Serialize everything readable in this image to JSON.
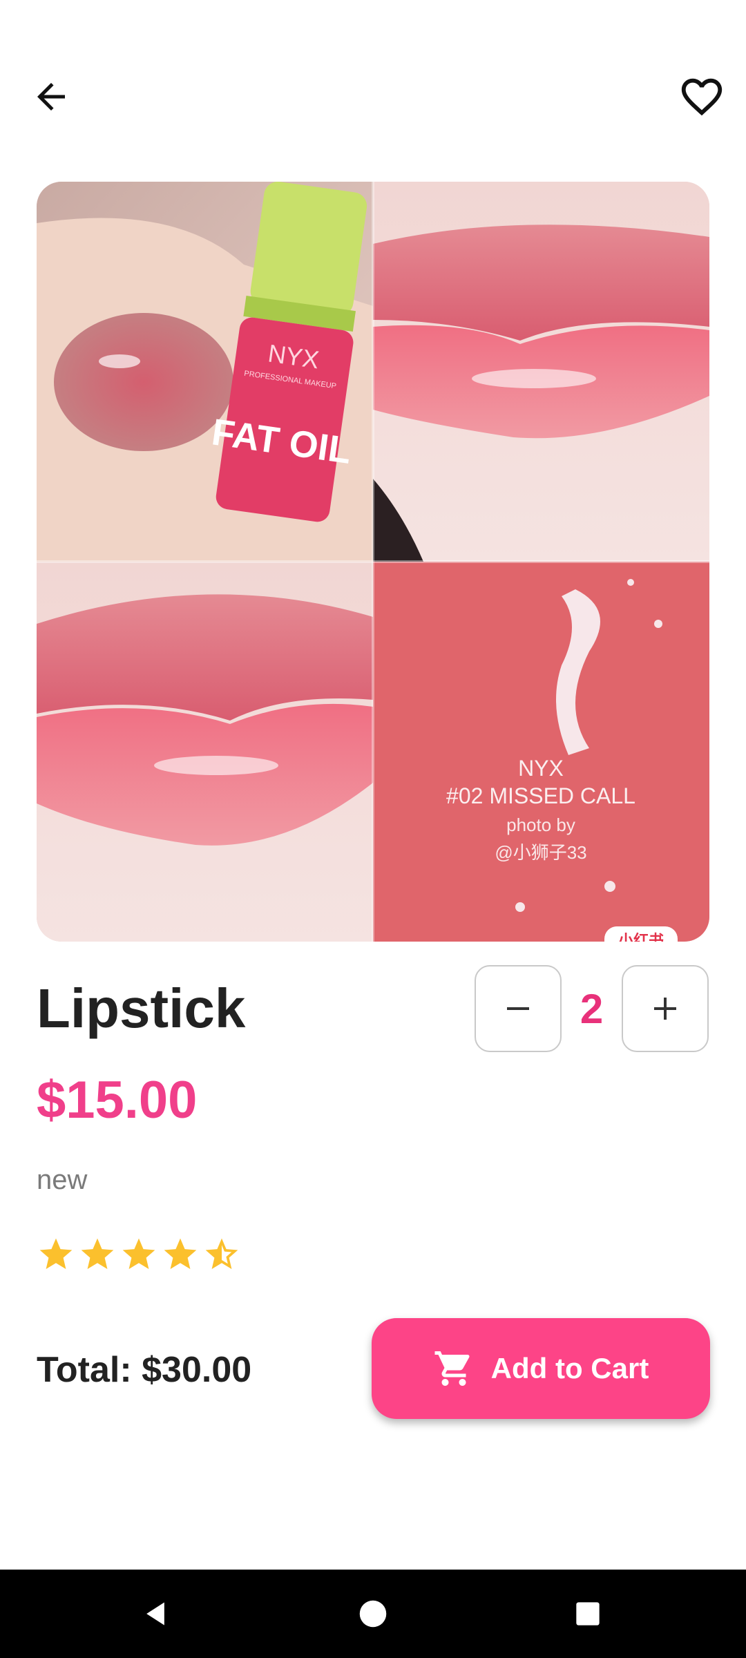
{
  "header": {
    "back_icon": "arrow-left-icon",
    "favorite_icon": "heart-outline-icon"
  },
  "product": {
    "image": {
      "overlay_lines": [
        "NYX",
        "#02 MISSED CALL",
        "photo by",
        "@小狮子33"
      ],
      "tube_brand": "NYX",
      "tube_tagline": "PROFESSIONAL MAKEUP",
      "tube_name": "FAT OIL",
      "corner_badge": "小红书"
    },
    "title": "Lipstick",
    "price": "$15.00",
    "description": "new",
    "rating": 4.5,
    "rating_max": 5
  },
  "quantity": {
    "value": "2",
    "minus_icon": "minus-icon",
    "plus_icon": "plus-icon"
  },
  "footer": {
    "total": "Total: $30.00",
    "add_to_cart_label": "Add to Cart",
    "cart_icon": "shopping-cart-icon"
  },
  "colors": {
    "accent": "#fd4487",
    "price": "#f03f8a",
    "quantity": "#e8317a",
    "star": "#fbc02d"
  },
  "system_nav": [
    "back-triangle-icon",
    "home-circle-icon",
    "recents-square-icon"
  ]
}
